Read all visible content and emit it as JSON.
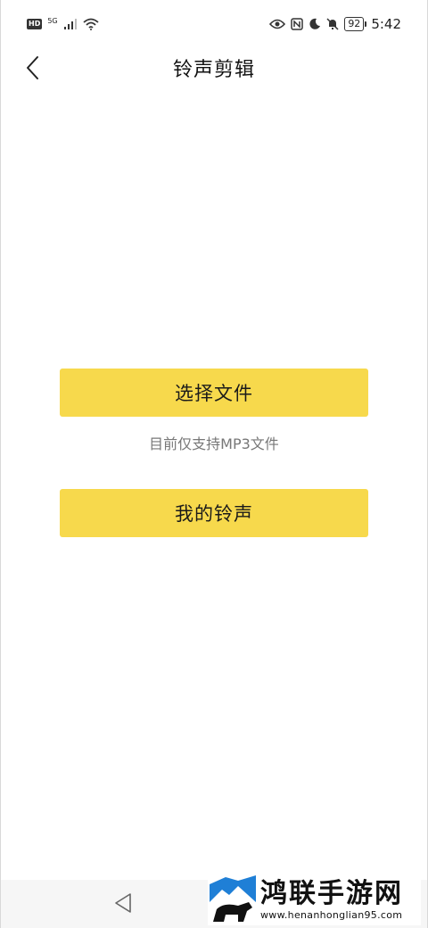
{
  "status_bar": {
    "hd_badge": "HD",
    "network": "5G",
    "battery": "92",
    "time": "5:42"
  },
  "header": {
    "title": "铃声剪辑"
  },
  "main": {
    "select_file_label": "选择文件",
    "hint": "目前仅支持MP3文件",
    "my_ringtones_label": "我的铃声"
  },
  "watermark": {
    "title": "鸿联手游网",
    "url": "www.henanhonglian95.com"
  },
  "colors": {
    "button_yellow": "#f7d94c",
    "hint_gray": "#777777"
  },
  "icons": [
    "back-chevron-icon",
    "eye-icon",
    "nfc-icon",
    "moon-icon",
    "bell-off-icon",
    "wifi-icon",
    "signal-icon",
    "nav-back-triangle-icon"
  ]
}
